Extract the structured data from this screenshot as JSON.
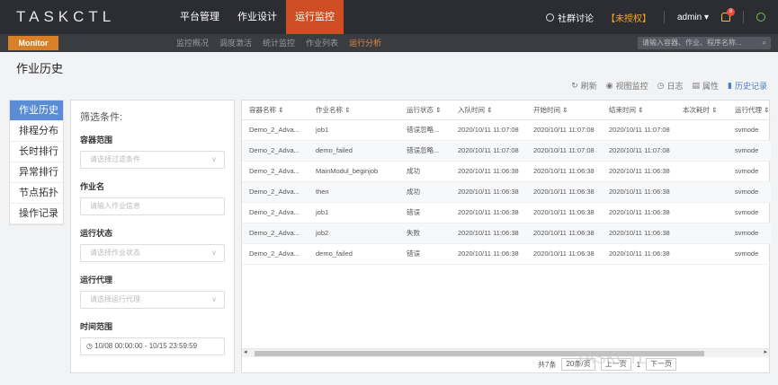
{
  "topbar": {
    "logo": "TASKCTL",
    "nav": [
      "平台管理",
      "作业设计",
      "运行监控"
    ],
    "active_nav": 2,
    "community": "社群讨论",
    "unauthorized": "【未授权】",
    "user": "admin ▾",
    "bell_count": "8"
  },
  "subbar": {
    "monitor": "Monitor",
    "nav": [
      "监控概况",
      "调度激活",
      "统计监控",
      "作业列表",
      "运行分析"
    ],
    "active_nav": 4,
    "search_placeholder": "请输入容器、作业、程序名称..."
  },
  "page_title": "作业历史",
  "toolbar": [
    "刷新",
    "视图监控",
    "日志",
    "属性",
    "历史记录"
  ],
  "sidenav": [
    "作业历史",
    "排程分布",
    "长时排行",
    "异常排行",
    "节点拓扑",
    "操作记录"
  ],
  "filter": {
    "title": "筛选条件:",
    "container_label": "容器范围",
    "container_placeholder": "请选择过滤条件",
    "job_label": "作业名",
    "job_placeholder": "请输入作业信息",
    "status_label": "运行状态",
    "status_placeholder": "请选择作业状态",
    "agent_label": "运行代理",
    "agent_placeholder": "请选择运行代理",
    "time_label": "时间范围",
    "time_value": "10/08 00:00:00 - 10/15 23:59:59"
  },
  "table": {
    "headers": [
      "容器名称 ⇕",
      "作业名称 ⇕",
      "运行状态 ⇕",
      "入队时间 ⇕",
      "开始时间 ⇕",
      "结束时间 ⇕",
      "本次耗时 ⇕",
      "运行代理 ⇕"
    ],
    "rows": [
      [
        "Demo_2_Adva...",
        "job1",
        "错误忽略...",
        "2020/10/11 11:07:08",
        "2020/10/11 11:07:08",
        "2020/10/11 11:07:08",
        "",
        "svmode"
      ],
      [
        "Demo_2_Adva...",
        "demo_failed",
        "错误忽略...",
        "2020/10/11 11:07:08",
        "2020/10/11 11:07:08",
        "2020/10/11 11:07:08",
        "",
        "svmode"
      ],
      [
        "Demo_2_Adva...",
        "MainModul_beginjob",
        "成功",
        "2020/10/11 11:06:38",
        "2020/10/11 11:06:38",
        "2020/10/11 11:06:38",
        "",
        "svmode"
      ],
      [
        "Demo_2_Adva...",
        "then",
        "成功",
        "2020/10/11 11:06:38",
        "2020/10/11 11:06:38",
        "2020/10/11 11:06:38",
        "",
        "svmode"
      ],
      [
        "Demo_2_Adva...",
        "job1",
        "错误",
        "2020/10/11 11:06:38",
        "2020/10/11 11:06:38",
        "2020/10/11 11:06:38",
        "",
        "svmode"
      ],
      [
        "Demo_2_Adva...",
        "job2",
        "失败",
        "2020/10/11 11:06:38",
        "2020/10/11 11:06:38",
        "2020/10/11 11:06:38",
        "",
        "svmode"
      ],
      [
        "Demo_2_Adva...",
        "demo_failed",
        "错误",
        "2020/10/11 11:06:38",
        "2020/10/11 11:06:38",
        "2020/10/11 11:06:38",
        "",
        "svmode"
      ]
    ]
  },
  "pager": {
    "total": "共7条",
    "page_size": "20条/页",
    "prev": "上一页",
    "page": "1",
    "next": "下一页"
  },
  "watermark": "TASKCTL"
}
